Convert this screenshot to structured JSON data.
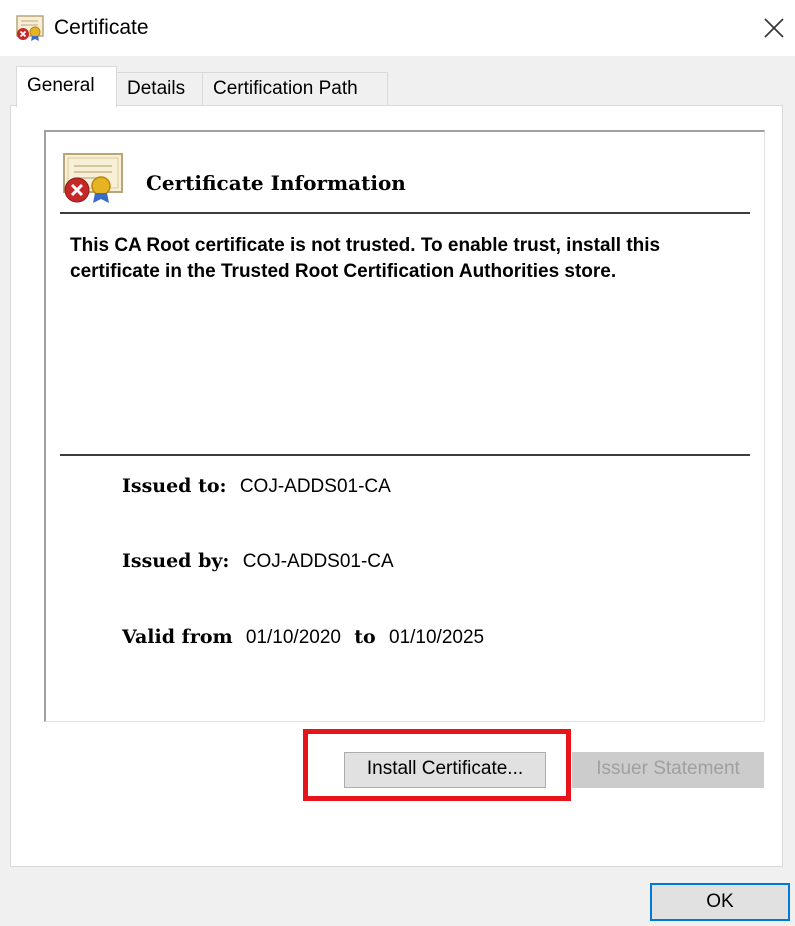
{
  "window": {
    "title": "Certificate",
    "icon": "certificate-error-icon",
    "close_icon": "close-icon"
  },
  "tabs": [
    {
      "label": "General",
      "active": true
    },
    {
      "label": "Details",
      "active": false
    },
    {
      "label": "Certification Path",
      "active": false
    }
  ],
  "general": {
    "heading": "Certificate Information",
    "heading_icon": "certificate-untrusted-icon",
    "warning": "This CA Root certificate is not trusted. To enable trust, install this certificate in the Trusted Root Certification Authorities store.",
    "issued_to_label": "Issued to:",
    "issued_to_value": "COJ-ADDS01-CA",
    "issued_by_label": "Issued by:",
    "issued_by_value": "COJ-ADDS01-CA",
    "valid_from_label": "Valid from",
    "valid_from_value": "01/10/2020",
    "valid_to_label": "to",
    "valid_to_value": "01/10/2025"
  },
  "buttons": {
    "install": "Install Certificate...",
    "issuer_statement": "Issuer Statement",
    "ok": "OK"
  },
  "colors": {
    "highlight": "#e8141b",
    "focus_border": "#0078d7",
    "error_red": "#c62828",
    "ribbon_gold": "#e6b422"
  }
}
